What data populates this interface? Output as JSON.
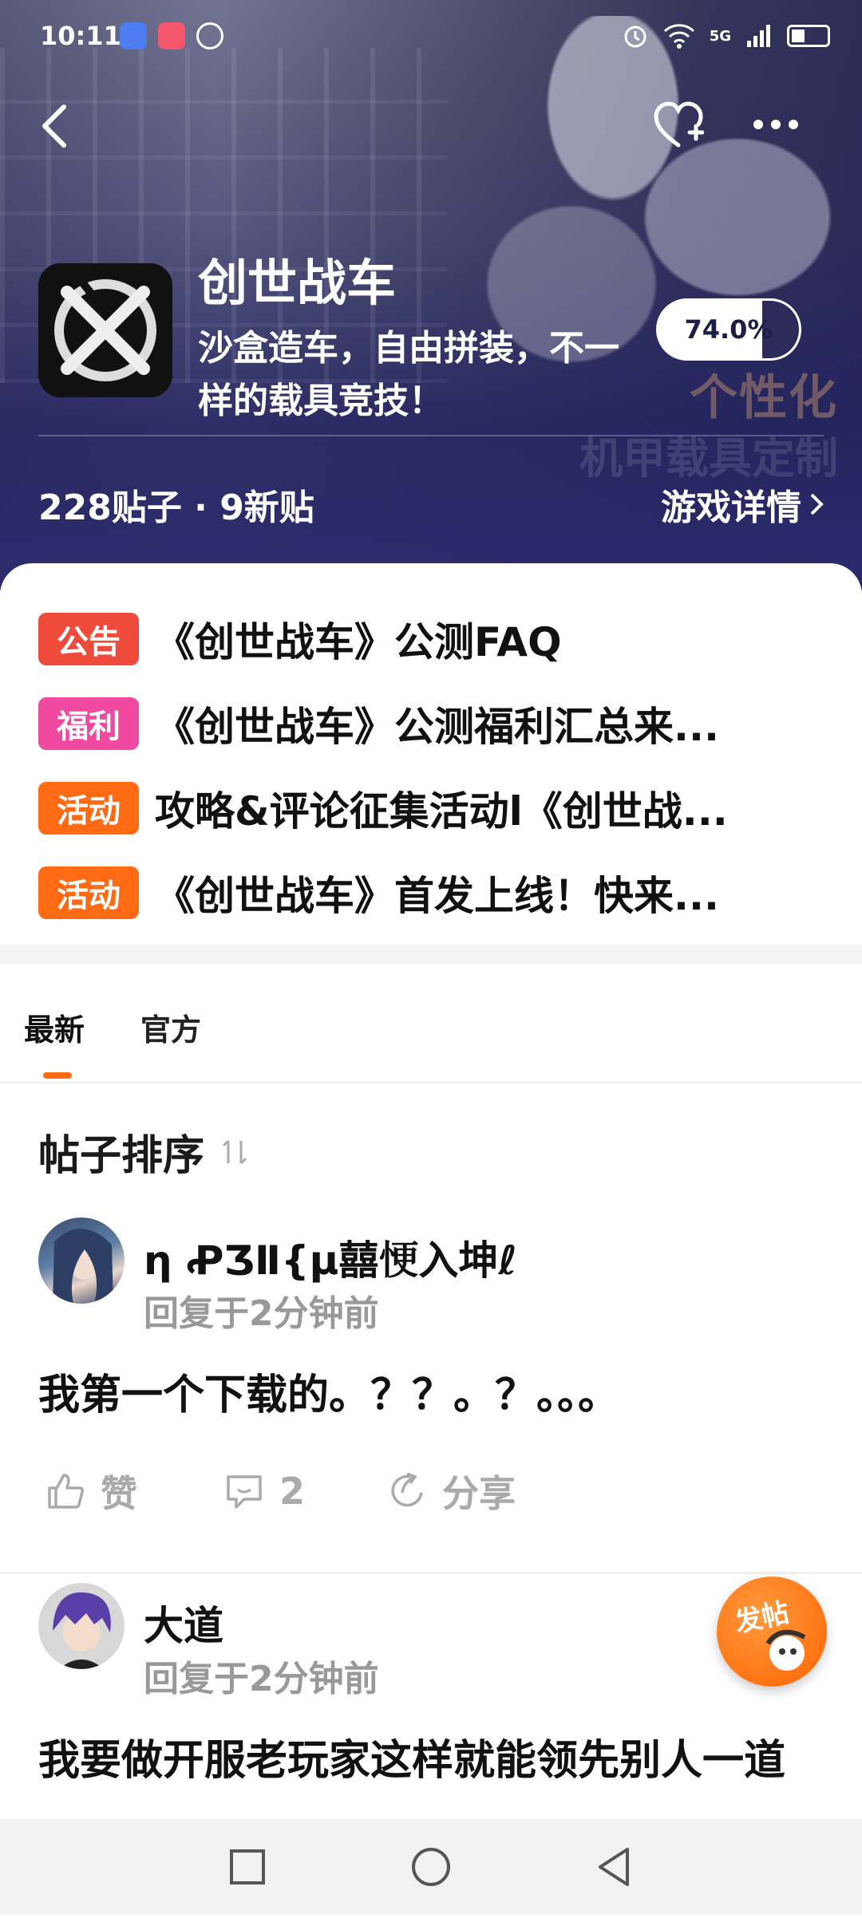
{
  "status_bar": {
    "time": "10:11",
    "network": "5G"
  },
  "header": {
    "game_title": "创世战车",
    "game_description": "沙盒造车，自由拼装，不一样的载具竞技！",
    "rating": 74.0,
    "rating_label": "74.0%",
    "post_stats": "228贴子 · 9新贴",
    "details_link": "游戏详情",
    "banner_watermark": "个性化",
    "banner_watermark2": "机甲载具定制"
  },
  "notices": [
    {
      "tag": "公告",
      "color": "#ee4b3b",
      "text": "《创世战车》公测FAQ"
    },
    {
      "tag": "福利",
      "color": "#f04aa0",
      "text": "《创世战车》公测福利汇总来..."
    },
    {
      "tag": "活动",
      "color": "#ff6a13",
      "text": "攻略&评论征集活动l《创世战..."
    },
    {
      "tag": "活动",
      "color": "#ff6a13",
      "text": "《创世战车》首发上线！快来..."
    }
  ],
  "tabs": {
    "latest": "最新",
    "official": "官方"
  },
  "sort": {
    "label": "帖子排序"
  },
  "posts": [
    {
      "author": "η ꝒƷⅡ{µ囍𢙾入坤ℓ",
      "time": "回复于2分钟前",
      "body": "我第一个下载的。？？。？。。。",
      "like_label": "赞",
      "comment_count": "2",
      "share_label": "分享"
    },
    {
      "author": "大道",
      "time": "回复于2分钟前",
      "body": "我要做开服老玩家这样就能领先别人一道"
    }
  ],
  "fab": {
    "label": "发帖"
  },
  "colors": {
    "accent": "#ff6a13",
    "banner_bg": "#2c2b6e"
  }
}
